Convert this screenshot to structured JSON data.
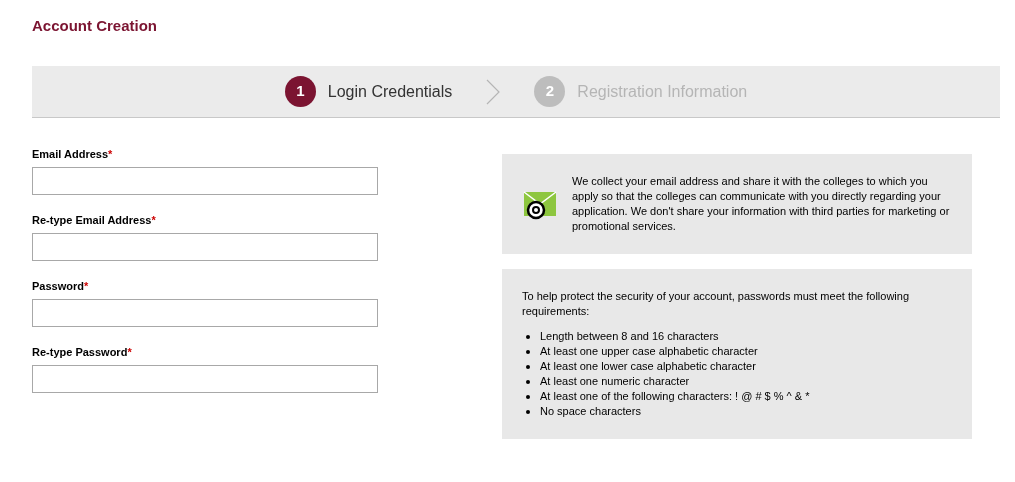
{
  "page_title": "Account Creation",
  "steps": [
    {
      "number": "1",
      "label": "Login Credentials",
      "selected": true
    },
    {
      "number": "2",
      "label": "Registration Information",
      "selected": false
    }
  ],
  "fields": [
    {
      "label": "Email Address",
      "required_mark": "*"
    },
    {
      "label": "Re-type Email Address",
      "required_mark": "*"
    },
    {
      "label": "Password",
      "required_mark": "*"
    },
    {
      "label": "Re-type Password",
      "required_mark": "*"
    }
  ],
  "email_notice": "We collect your email address and share it with the colleges to which you apply so that the colleges can communicate with you directly regarding your application. We don't share your information with third parties for marketing or promotional services.",
  "password_notice": {
    "intro": "To help protect the security of your account, passwords must meet the following requirements:",
    "requirements": [
      "Length between 8 and 16 characters",
      "At least one upper case alphabetic character",
      "At least one lower case alphabetic character",
      "At least one numeric character",
      "At least one of the following characters: ! @ # $ % ^ & *",
      "No space characters"
    ]
  }
}
